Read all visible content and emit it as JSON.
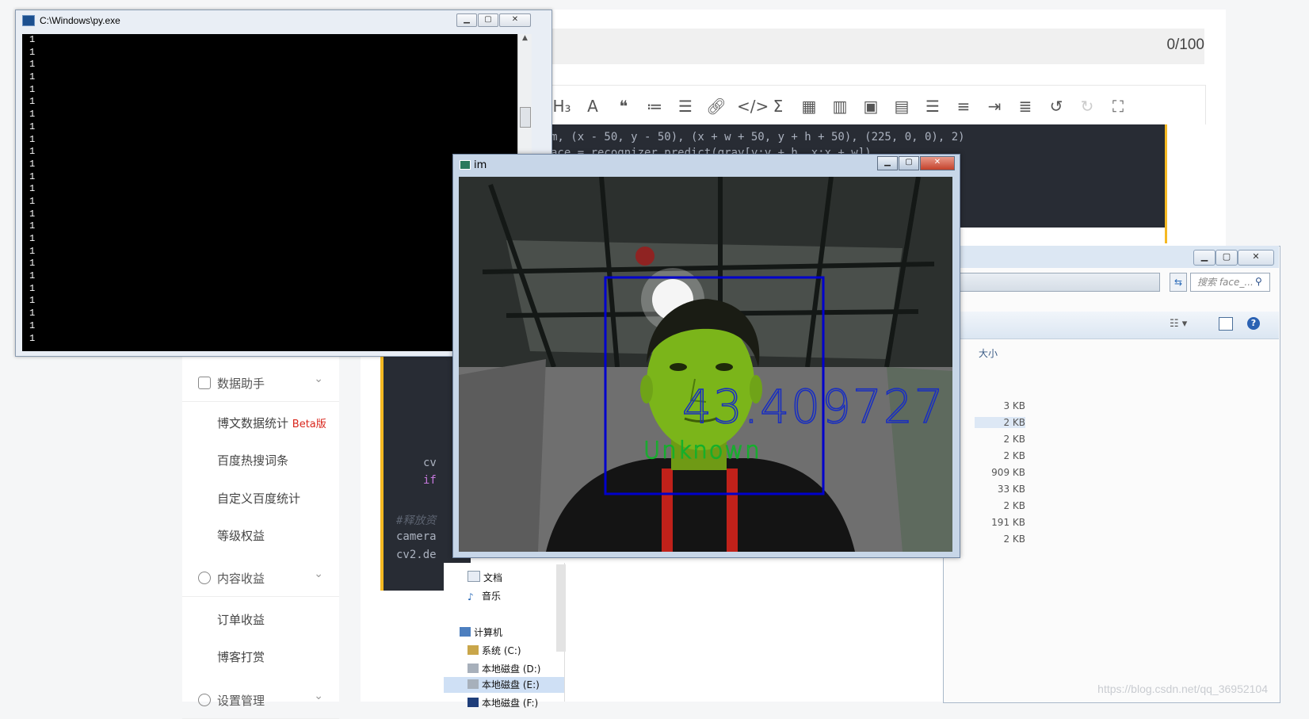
{
  "editor": {
    "title_counter": "0/100",
    "toolbar_icons": [
      "heading-icon",
      "font-color-icon",
      "quote-icon",
      "ordered-list-icon",
      "unordered-list-icon",
      "link-icon",
      "code-icon",
      "sum-icon",
      "table-icon",
      "chart-icon",
      "image-icon",
      "video-icon",
      "divider-icon",
      "toc-icon",
      "indent-icon",
      "outdent-icon",
      "undo-icon",
      "redo-icon",
      "fullscreen-icon"
    ],
    "code_line_1": "m, (x - 50, y - 50), (x + w + 50, y + h + 50), (225, 0, 0), 2)",
    "code_line_2": "ace = recognizer.predict(gray[y:y + h, x:x + w])"
  },
  "sidebar": {
    "section_data": "数据助手",
    "items_data": [
      "博文数据统计",
      "百度热搜词条",
      "自定义百度统计",
      "等级权益"
    ],
    "beta": "Beta版",
    "section_income": "内容收益",
    "items_income": [
      "订单收益",
      "博客打赏"
    ],
    "section_settings": "设置管理"
  },
  "code_block2": {
    "l1": "cv",
    "l2": "if",
    "comment": "#释放资",
    "l3": "camera",
    "l4": "cv2.de"
  },
  "console": {
    "title": "C:\\Windows\\py.exe",
    "lines": [
      "1",
      "1",
      "1",
      "1",
      "1",
      "1",
      "1",
      "1",
      "1",
      "1",
      "1",
      "1",
      "1",
      "1",
      "1",
      "1",
      "1",
      "1",
      "1",
      "1",
      "1",
      "1",
      "1",
      "1",
      "1"
    ]
  },
  "camera": {
    "title": "im",
    "confidence": "43.409727",
    "label": "Unknown",
    "box_color": "#0000cc",
    "confidence_color": "#1a2fbf",
    "label_color": "#13b02b"
  },
  "explorer": {
    "search_placeholder": "搜索 face_...",
    "size_header": "大小",
    "sizes": [
      "3 KB",
      "2 KB",
      "2 KB",
      "2 KB",
      "909 KB",
      "33 KB",
      "2 KB",
      "191 KB",
      "2 KB"
    ],
    "nav_docs": "文档",
    "nav_music": "音乐",
    "nav_computer": "计算机",
    "nav_c": "系统 (C:)",
    "nav_d": "本地磁盘 (D:)",
    "nav_e": "本地磁盘 (E:)",
    "nav_f": "本地磁盘 (F:)"
  },
  "watermark": "https://blog.csdn.net/qq_36952104"
}
